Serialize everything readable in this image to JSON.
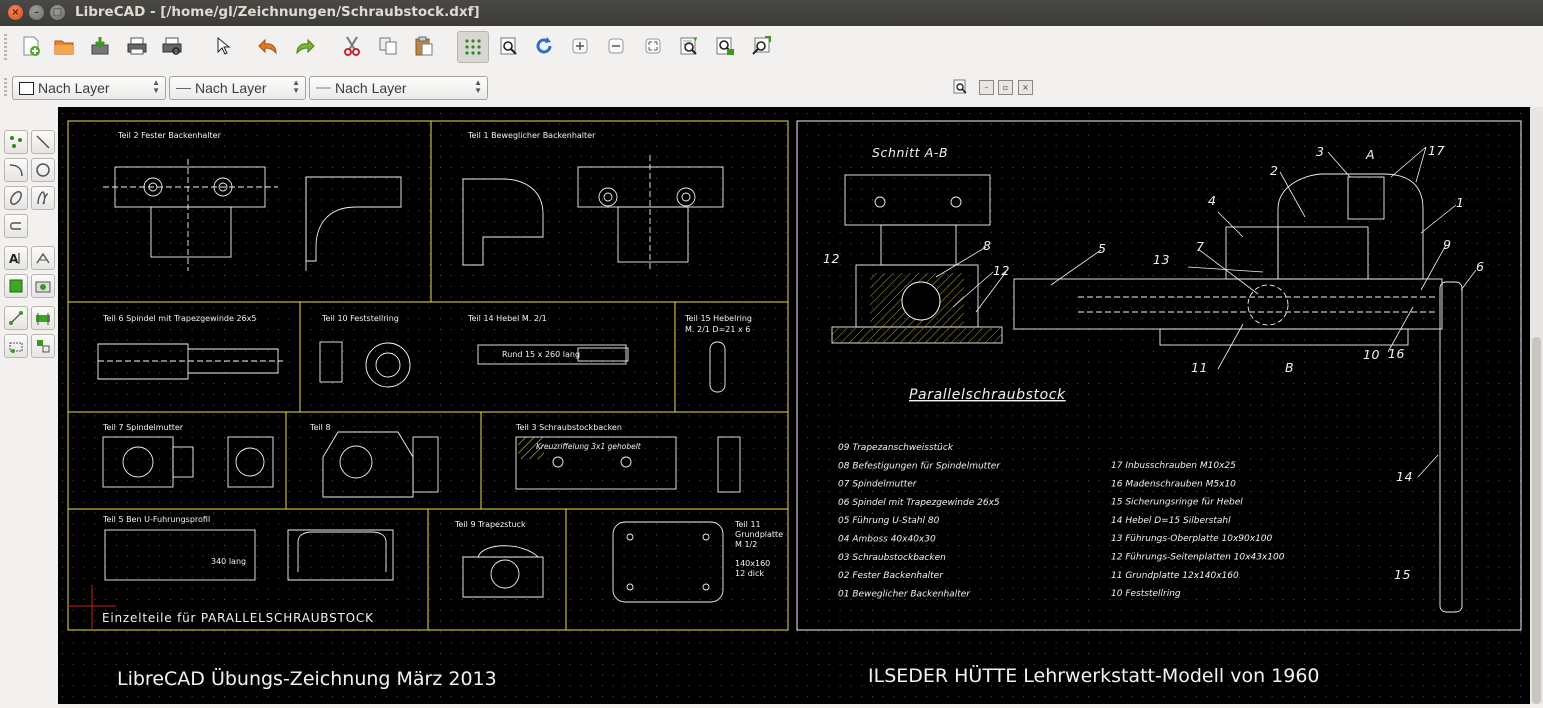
{
  "window": {
    "title": "LibreCAD - [/home/gl/Zeichnungen/Schraubstock.dxf]"
  },
  "toolbar": {
    "buttons": [
      "new-file",
      "open-file",
      "save-file",
      "print",
      "print-preview",
      "select-pointer",
      "undo",
      "redo",
      "cut",
      "copy",
      "paste",
      "grid-toggle",
      "zoom-window",
      "redraw",
      "zoom-in",
      "zoom-out",
      "zoom-auto",
      "zoom-previous",
      "zoom-selection",
      "zoom-pan"
    ]
  },
  "pen_toolbar": {
    "color": "Nach Layer",
    "width": "Nach Layer",
    "linetype": "Nach Layer"
  },
  "colors": {
    "canvas": "#000000",
    "frame_yellow": "#e6df4a",
    "grid_dot": "#5a5a5a",
    "drawing_white": "#f2f2f2",
    "origin_red": "#c81e1e",
    "title_bar": "#3c3b37"
  },
  "drawing": {
    "left_sheet": {
      "footer_title": "Einzelteile für PARALLELSCHRAUBSTOCK",
      "cells": [
        {
          "label": "Teil 2  Fester Backenhalter"
        },
        {
          "label": "Teil 1  Beweglicher Backenhalter"
        },
        {
          "label": "Teil 6   Spindel mit Trapezgewinde 26x5"
        },
        {
          "label": "Teil 10   Feststellring"
        },
        {
          "label": "Teil 14   Hebel   M. 2/1"
        },
        {
          "label": "Teil 15  Hebelring"
        },
        {
          "label": "M. 2/1       D=21 x 6"
        },
        {
          "label": "Teil 7   Spindelmutter"
        },
        {
          "label": "Teil 8"
        },
        {
          "label": "Teil 3  Schraubstockbacken"
        },
        {
          "label": "Teil 5   Ben  U-Fuhrungsprofil"
        },
        {
          "label": "Teil 9   Trapezstuck"
        },
        {
          "label": "Teil 11"
        },
        {
          "label": "Grundplatte"
        },
        {
          "label": "M 1/2"
        },
        {
          "label": "140x160"
        },
        {
          "label": "12 dick"
        }
      ],
      "inner_texts": {
        "rund": "Rund 15 x 260 lang",
        "kreuz": "Kreuzriffelung 3x1 gehobelt",
        "lang340": "340 lang"
      }
    },
    "right_sheet": {
      "section_label": "Schnitt  A-B",
      "title": "Parallelschraubstock",
      "callouts": [
        "3",
        "A",
        "17",
        "2",
        "1",
        "4",
        "5",
        "13",
        "7",
        "8",
        "12",
        "12",
        "9",
        "6",
        "11",
        "B",
        "10",
        "16",
        "14",
        "15"
      ],
      "parts_left": [
        "09  Trapezanschweisstück",
        "08  Befestigungen für Spindelmutter",
        "07  Spindelmutter",
        "06  Spindel mit Trapezgewinde 26x5",
        "05  Führung  U-Stahl 80",
        "04  Amboss 40x40x30",
        "03  Schraubstockbacken",
        "02  Fester Backenhalter",
        "01  Beweglicher Backenhalter"
      ],
      "parts_right": [
        "17  Inbusschrauben M10x25",
        "16  Madenschrauben M5x10",
        "15  Sicherungsringe für Hebel",
        "14  Hebel  D=15  Silberstahl",
        "13  Führungs-Oberplatte  10x90x100",
        "12  Führungs-Seitenplatten 10x43x100",
        "11  Grundplatte 12x140x160",
        "10  Feststellring"
      ]
    },
    "footer_left": "LibreCAD   Übungs-Zeichnung  März 2013",
    "footer_right": "ILSEDER HÜTTE  Lehrwerkstatt-Modell von 1960"
  }
}
